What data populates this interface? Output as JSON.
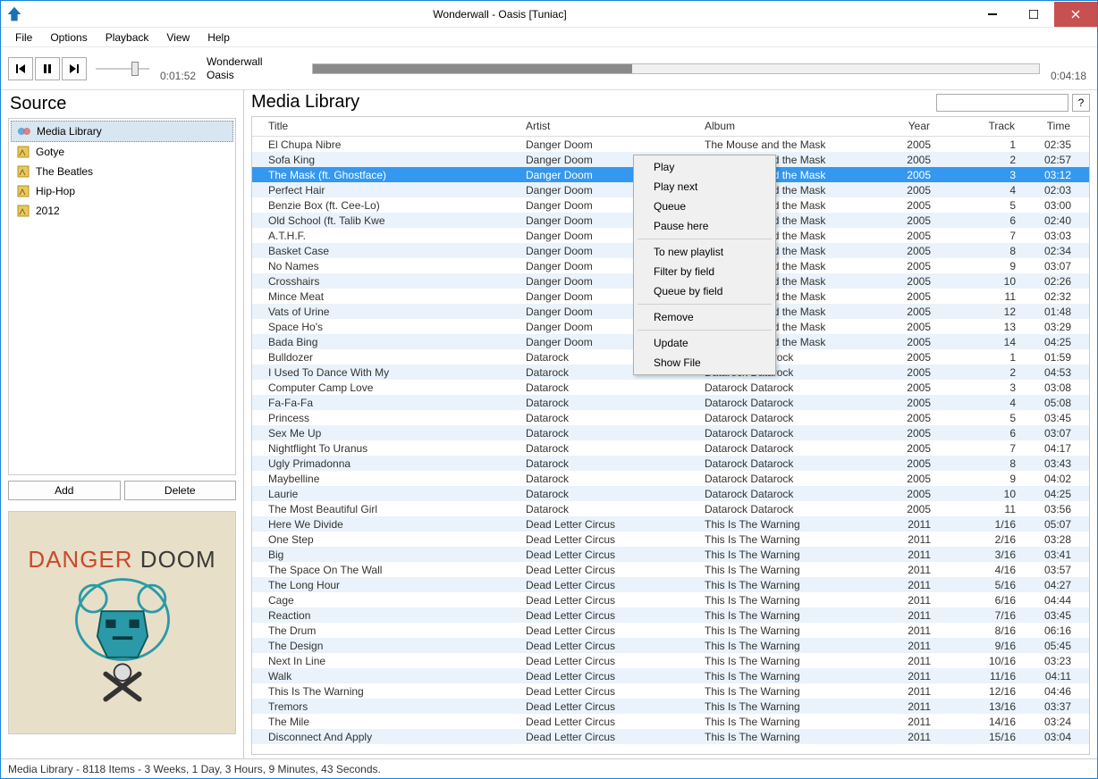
{
  "window_title": "Wonderwall - Oasis [Tuniac]",
  "menu": [
    "File",
    "Options",
    "Playback",
    "View",
    "Help"
  ],
  "player": {
    "now_title": "Wonderwall",
    "now_artist": "Oasis",
    "time_current": "0:01:52",
    "time_total": "0:04:18"
  },
  "left": {
    "header": "Source",
    "items": [
      "Media Library",
      "Gotye",
      "The Beatles",
      "Hip-Hop",
      "2012"
    ],
    "buttons": {
      "add": "Add",
      "delete": "Delete"
    },
    "album_art": {
      "word1": "DANGER",
      "word2": "DOOM"
    }
  },
  "right": {
    "header": "Media Library",
    "search_placeholder": "",
    "help": "?",
    "columns": [
      "Title",
      "Artist",
      "Album",
      "Year",
      "Track",
      "Time"
    ],
    "tracks": [
      {
        "title": "El Chupa Nibre",
        "artist": "Danger Doom",
        "album": "The Mouse and the Mask",
        "year": "2005",
        "track": "1",
        "time": "02:35"
      },
      {
        "title": "Sofa King",
        "artist": "Danger Doom",
        "album": "The Mouse and the Mask",
        "year": "2005",
        "track": "2",
        "time": "02:57"
      },
      {
        "title": "The Mask (ft. Ghostface)",
        "artist": "Danger Doom",
        "album": "The Mouse and the Mask",
        "year": "2005",
        "track": "3",
        "time": "03:12",
        "selected": true
      },
      {
        "title": "Perfect Hair",
        "artist": "Danger Doom",
        "album": "The Mouse and the Mask",
        "year": "2005",
        "track": "4",
        "time": "02:03"
      },
      {
        "title": "Benzie Box (ft. Cee-Lo)",
        "artist": "Danger Doom",
        "album": "The Mouse and the Mask",
        "year": "2005",
        "track": "5",
        "time": "03:00"
      },
      {
        "title": "Old School (ft. Talib Kwe",
        "artist": "Danger Doom",
        "album": "The Mouse and the Mask",
        "year": "2005",
        "track": "6",
        "time": "02:40"
      },
      {
        "title": "A.T.H.F.",
        "artist": "Danger Doom",
        "album": "The Mouse and the Mask",
        "year": "2005",
        "track": "7",
        "time": "03:03"
      },
      {
        "title": "Basket Case",
        "artist": "Danger Doom",
        "album": "The Mouse and the Mask",
        "year": "2005",
        "track": "8",
        "time": "02:34"
      },
      {
        "title": "No Names",
        "artist": "Danger Doom",
        "album": "The Mouse and the Mask",
        "year": "2005",
        "track": "9",
        "time": "03:07"
      },
      {
        "title": "Crosshairs",
        "artist": "Danger Doom",
        "album": "The Mouse and the Mask",
        "year": "2005",
        "track": "10",
        "time": "02:26"
      },
      {
        "title": "Mince Meat",
        "artist": "Danger Doom",
        "album": "The Mouse and the Mask",
        "year": "2005",
        "track": "11",
        "time": "02:32"
      },
      {
        "title": "Vats of Urine",
        "artist": "Danger Doom",
        "album": "The Mouse and the Mask",
        "year": "2005",
        "track": "12",
        "time": "01:48"
      },
      {
        "title": "Space Ho's",
        "artist": "Danger Doom",
        "album": "The Mouse and the Mask",
        "year": "2005",
        "track": "13",
        "time": "03:29"
      },
      {
        "title": "Bada Bing",
        "artist": "Danger Doom",
        "album": "The Mouse and the Mask",
        "year": "2005",
        "track": "14",
        "time": "04:25"
      },
      {
        "title": "Bulldozer",
        "artist": "Datarock",
        "album": "Datarock Datarock",
        "year": "2005",
        "track": "1",
        "time": "01:59"
      },
      {
        "title": "I Used To Dance With My",
        "artist": "Datarock",
        "album": "Datarock Datarock",
        "year": "2005",
        "track": "2",
        "time": "04:53"
      },
      {
        "title": "Computer Camp Love",
        "artist": "Datarock",
        "album": "Datarock Datarock",
        "year": "2005",
        "track": "3",
        "time": "03:08"
      },
      {
        "title": "Fa-Fa-Fa",
        "artist": "Datarock",
        "album": "Datarock Datarock",
        "year": "2005",
        "track": "4",
        "time": "05:08"
      },
      {
        "title": "Princess",
        "artist": "Datarock",
        "album": "Datarock Datarock",
        "year": "2005",
        "track": "5",
        "time": "03:45"
      },
      {
        "title": "Sex Me Up",
        "artist": "Datarock",
        "album": "Datarock Datarock",
        "year": "2005",
        "track": "6",
        "time": "03:07"
      },
      {
        "title": "Nightflight To Uranus",
        "artist": "Datarock",
        "album": "Datarock Datarock",
        "year": "2005",
        "track": "7",
        "time": "04:17"
      },
      {
        "title": "Ugly Primadonna",
        "artist": "Datarock",
        "album": "Datarock Datarock",
        "year": "2005",
        "track": "8",
        "time": "03:43"
      },
      {
        "title": "Maybelline",
        "artist": "Datarock",
        "album": "Datarock Datarock",
        "year": "2005",
        "track": "9",
        "time": "04:02"
      },
      {
        "title": "Laurie",
        "artist": "Datarock",
        "album": "Datarock Datarock",
        "year": "2005",
        "track": "10",
        "time": "04:25"
      },
      {
        "title": "The Most Beautiful Girl",
        "artist": "Datarock",
        "album": "Datarock Datarock",
        "year": "2005",
        "track": "11",
        "time": "03:56"
      },
      {
        "title": "Here We Divide",
        "artist": "Dead Letter Circus",
        "album": "This Is The Warning",
        "year": "2011",
        "track": "1/16",
        "time": "05:07"
      },
      {
        "title": "One Step",
        "artist": "Dead Letter Circus",
        "album": "This Is The Warning",
        "year": "2011",
        "track": "2/16",
        "time": "03:28"
      },
      {
        "title": "Big",
        "artist": "Dead Letter Circus",
        "album": "This Is The Warning",
        "year": "2011",
        "track": "3/16",
        "time": "03:41"
      },
      {
        "title": "The Space On The Wall",
        "artist": "Dead Letter Circus",
        "album": "This Is The Warning",
        "year": "2011",
        "track": "4/16",
        "time": "03:57"
      },
      {
        "title": "The Long Hour",
        "artist": "Dead Letter Circus",
        "album": "This Is The Warning",
        "year": "2011",
        "track": "5/16",
        "time": "04:27"
      },
      {
        "title": "Cage",
        "artist": "Dead Letter Circus",
        "album": "This Is The Warning",
        "year": "2011",
        "track": "6/16",
        "time": "04:44"
      },
      {
        "title": "Reaction",
        "artist": "Dead Letter Circus",
        "album": "This Is The Warning",
        "year": "2011",
        "track": "7/16",
        "time": "03:45"
      },
      {
        "title": "The Drum",
        "artist": "Dead Letter Circus",
        "album": "This Is The Warning",
        "year": "2011",
        "track": "8/16",
        "time": "06:16"
      },
      {
        "title": "The Design",
        "artist": "Dead Letter Circus",
        "album": "This Is The Warning",
        "year": "2011",
        "track": "9/16",
        "time": "05:45"
      },
      {
        "title": "Next In Line",
        "artist": "Dead Letter Circus",
        "album": "This Is The Warning",
        "year": "2011",
        "track": "10/16",
        "time": "03:23"
      },
      {
        "title": "Walk",
        "artist": "Dead Letter Circus",
        "album": "This Is The Warning",
        "year": "2011",
        "track": "11/16",
        "time": "04:11"
      },
      {
        "title": "This Is The Warning",
        "artist": "Dead Letter Circus",
        "album": "This Is The Warning",
        "year": "2011",
        "track": "12/16",
        "time": "04:46"
      },
      {
        "title": "Tremors",
        "artist": "Dead Letter Circus",
        "album": "This Is The Warning",
        "year": "2011",
        "track": "13/16",
        "time": "03:37"
      },
      {
        "title": "The Mile",
        "artist": "Dead Letter Circus",
        "album": "This Is The Warning",
        "year": "2011",
        "track": "14/16",
        "time": "03:24"
      },
      {
        "title": "Disconnect And Apply",
        "artist": "Dead Letter Circus",
        "album": "This Is The Warning",
        "year": "2011",
        "track": "15/16",
        "time": "03:04"
      }
    ]
  },
  "context_menu": [
    "Play",
    "Play next",
    "Queue",
    "Pause here",
    "-",
    "To new playlist",
    "Filter by field",
    "Queue by field",
    "-",
    "Remove",
    "-",
    "Update",
    "Show File"
  ],
  "statusbar": "Media Library - 8118 Items - 3 Weeks, 1 Day, 3 Hours, 9 Minutes, 43 Seconds."
}
